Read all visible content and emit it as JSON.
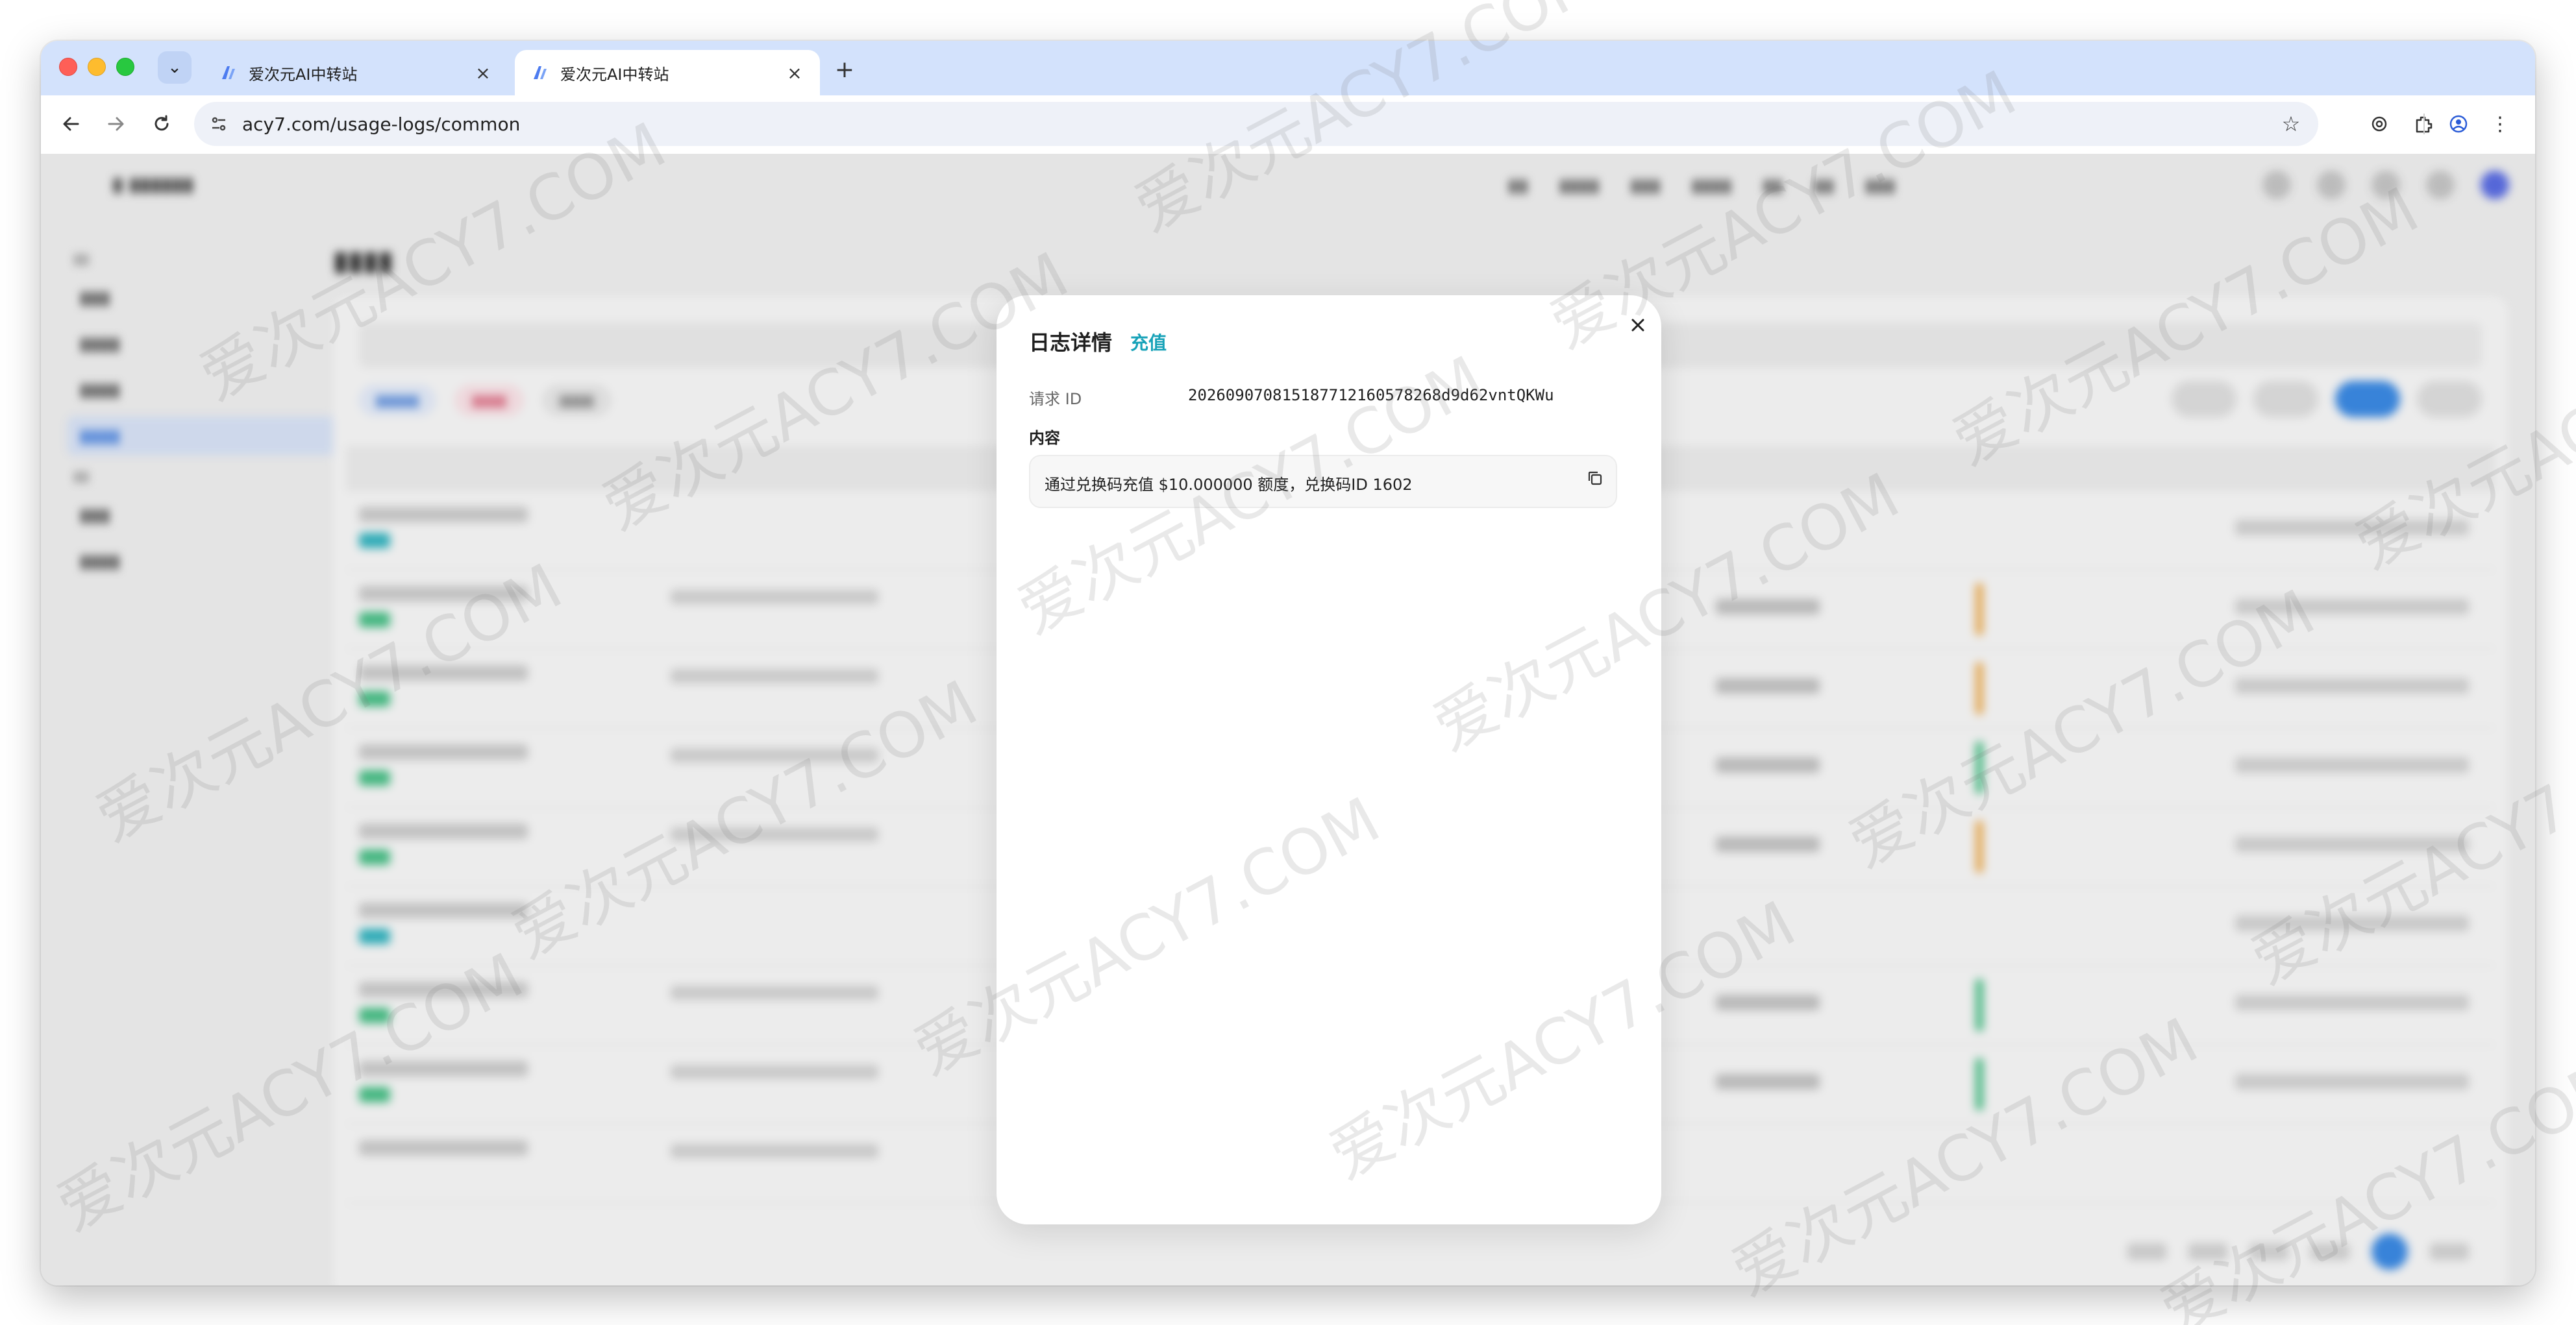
{
  "browser": {
    "tabs": [
      {
        "title": "爱次元AI中转站",
        "active": false
      },
      {
        "title": "爱次元AI中转站",
        "active": true
      }
    ],
    "url": "acy7.com/usage-logs/common"
  },
  "modal": {
    "title": "日志详情",
    "tag": "充值",
    "request_id_label": "请求 ID",
    "request_id_value": "202609070815187712160578268d9d62vntQKWu",
    "content_label": "内容",
    "content_text": "通过兑换码充值 $10.000000 额度，兑换码ID 1602"
  },
  "watermark": "爱次元ACY7.COM",
  "colors": {
    "tab_strip": "#d3e2fc",
    "tag_teal": "#17a2b8",
    "accent_blue": "#3c8ce7"
  },
  "icons": [
    "dropdown-chevron-icon",
    "favicon-icon",
    "close-icon",
    "plus-icon",
    "back-arrow-icon",
    "forward-arrow-icon",
    "reload-icon",
    "site-settings-icon",
    "star-icon",
    "chatgpt-icon",
    "extensions-icon",
    "profile-icon",
    "more-menu-icon",
    "copy-icon"
  ]
}
